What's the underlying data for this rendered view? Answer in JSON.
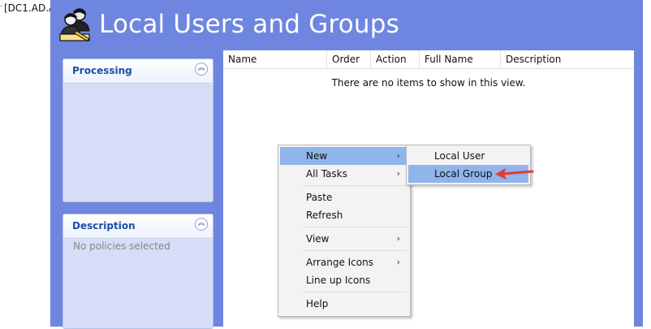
{
  "left_panel": {
    "path_text": "[DC1.AD.A"
  },
  "window": {
    "title": "Local Users and Groups",
    "icon": "users-groups-icon"
  },
  "panels": {
    "processing": {
      "title": "Processing",
      "collapse_icon": "chevron-double-up-icon"
    },
    "description": {
      "title": "Description",
      "body": "No policies selected",
      "collapse_icon": "chevron-double-up-icon"
    }
  },
  "list": {
    "columns": [
      "Name",
      "Order",
      "Action",
      "Full Name",
      "Description"
    ],
    "empty_message": "There are no items to show in this view."
  },
  "context_menu": {
    "items": [
      {
        "label": "New",
        "has_submenu": true,
        "highlighted": true
      },
      {
        "label": "All Tasks",
        "has_submenu": true
      },
      {
        "label": "Paste"
      },
      {
        "label": "Refresh"
      },
      {
        "label": "View",
        "has_submenu": true
      },
      {
        "label": "Arrange Icons",
        "has_submenu": true
      },
      {
        "label": "Line up Icons"
      },
      {
        "label": "Help"
      }
    ],
    "submenu_glyph": "›"
  },
  "submenu": {
    "items": [
      {
        "label": "Local User"
      },
      {
        "label": "Local Group",
        "highlighted": true
      }
    ]
  },
  "colors": {
    "window_blue": "#6e86df",
    "panel_blue": "#d5def6",
    "highlight": "#8fb5ea",
    "annotation_arrow": "#e53935"
  }
}
